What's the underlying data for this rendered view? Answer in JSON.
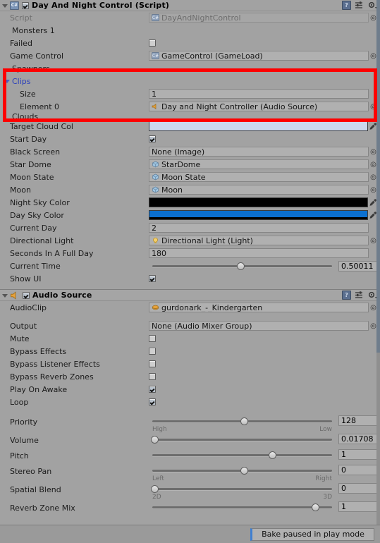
{
  "script_component": {
    "title": "Day And Night Control (Script)",
    "enabled": true,
    "icon": "csharp-script-icon",
    "header_icons": [
      "help-book-icon",
      "preset-icon",
      "gear-icon"
    ],
    "rows": [
      {
        "label": "Script",
        "type": "object",
        "value": "DayAndNightControl",
        "icon": "csharp-script-icon",
        "readonly": true
      },
      {
        "label": "Monsters 1",
        "type": "foldout",
        "value": ""
      },
      {
        "label": "Failed",
        "type": "checkbox",
        "value": false
      },
      {
        "label": "Game Control",
        "type": "object",
        "value": "GameControl (GameLoad)",
        "icon": "csharp-script-icon"
      },
      {
        "label": "Spawners",
        "type": "foldout",
        "value": ""
      }
    ],
    "clips": {
      "label": "Clips",
      "size_label": "Size",
      "size_value": "1",
      "element_label": "Element 0",
      "element_value": "Day and Night Controller (Audio Source)",
      "element_icon": "audio-source-icon"
    },
    "clouds_label": "Clouds",
    "rows2": [
      {
        "label": "Target Cloud Col",
        "type": "color",
        "value": "#ccd8ef",
        "alpha": "#ccd8ef"
      },
      {
        "label": "Start Day",
        "type": "checkbox",
        "value": true
      },
      {
        "label": "Black Screen",
        "type": "object",
        "value": "None (Image)",
        "icon": ""
      },
      {
        "label": "Star Dome",
        "type": "object",
        "value": "StarDome",
        "icon": "gameobject-icon"
      },
      {
        "label": "Moon State",
        "type": "object",
        "value": "Moon State",
        "icon": "gameobject-icon"
      },
      {
        "label": "Moon",
        "type": "object",
        "value": "Moon",
        "icon": "gameobject-icon"
      },
      {
        "label": "Night Sky Color",
        "type": "color",
        "value": "#000000",
        "alpha": "#000000"
      },
      {
        "label": "Day Sky Color",
        "type": "color",
        "value": "#0b70d1",
        "alpha": "#000000"
      },
      {
        "label": "Current Day",
        "type": "number",
        "value": "2"
      },
      {
        "label": "Directional Light",
        "type": "object",
        "value": "Directional Light (Light)",
        "icon": "light-icon"
      },
      {
        "label": "Seconds In A Full Day",
        "type": "number",
        "value": "180"
      },
      {
        "label": "Current Time",
        "type": "slider",
        "value": "0.50011",
        "pos": 47
      },
      {
        "label": "Show UI",
        "type": "checkbox",
        "value": true
      }
    ]
  },
  "audio_component": {
    "title": "Audio Source",
    "enabled": true,
    "icon": "audio-source-icon",
    "header_icons": [
      "help-book-icon",
      "preset-icon",
      "gear-icon"
    ],
    "rows": [
      {
        "label": "AudioClip",
        "type": "object",
        "value": "gurdonark_-_Kindergarten",
        "icon": "audio-clip-icon"
      },
      {
        "label": "Output",
        "type": "object",
        "value": "None (Audio Mixer Group)",
        "icon": ""
      },
      {
        "label": "Mute",
        "type": "checkbox",
        "value": false
      },
      {
        "label": "Bypass Effects",
        "type": "checkbox",
        "value": false
      },
      {
        "label": "Bypass Listener Effects",
        "type": "checkbox",
        "value": false
      },
      {
        "label": "Bypass Reverb Zones",
        "type": "checkbox",
        "value": false
      },
      {
        "label": "Play On Awake",
        "type": "checkbox",
        "value": true
      },
      {
        "label": "Loop",
        "type": "checkbox",
        "value": true
      }
    ],
    "sliders": [
      {
        "label": "Priority",
        "value": "128",
        "pos": 49,
        "left_caption": "High",
        "right_caption": "Low"
      },
      {
        "label": "Volume",
        "value": "0.01708",
        "pos": 1,
        "left_caption": "",
        "right_caption": ""
      },
      {
        "label": "Pitch",
        "value": "1",
        "pos": 64,
        "left_caption": "",
        "right_caption": ""
      },
      {
        "label": "Stereo Pan",
        "value": "0",
        "pos": 49,
        "left_caption": "Left",
        "right_caption": "Right"
      },
      {
        "label": "Spatial Blend",
        "value": "0",
        "pos": 1,
        "left_caption": "2D",
        "right_caption": "3D"
      },
      {
        "label": "Reverb Zone Mix",
        "value": "1",
        "pos": 87,
        "left_caption": "",
        "right_caption": ""
      }
    ]
  },
  "footer": {
    "bake_label": "Bake paused in play mode"
  },
  "colors": {
    "background": "#a2a2a2",
    "field": "#b0b0b0",
    "accent_blue": "#2b3fbb",
    "annotation_red": "#fe0000",
    "day_sky": "#0b70d1",
    "night_sky": "#000000",
    "target_cloud": "#ccd8ef"
  }
}
